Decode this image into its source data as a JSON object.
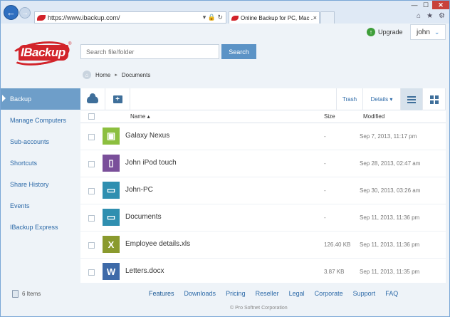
{
  "browser": {
    "url": "https://www.ibackup.com/",
    "tab_title": "Online Backup for PC, Mac ...",
    "tab_close": "×",
    "addr_controls": "▾ 🔒 ↻",
    "win_min": "—",
    "win_max": "☐",
    "win_close": "✕",
    "toolbar_icons": [
      "⌂",
      "★",
      "⚙"
    ]
  },
  "header": {
    "upgrade_label": "Upgrade",
    "upgrade_icon": "↑",
    "user_name": "john",
    "user_caret": "⌄",
    "logo_text": "IBackup",
    "logo_reg": "®"
  },
  "search": {
    "placeholder": "Search file/folder",
    "button": "Search"
  },
  "breadcrumb": {
    "home": "Home",
    "sep": "▸",
    "current": "Documents"
  },
  "sidebar": {
    "items": [
      {
        "label": "Backup",
        "active": true
      },
      {
        "label": "Manage Computers"
      },
      {
        "label": "Sub-accounts"
      },
      {
        "label": "Shortcuts"
      },
      {
        "label": "Share History"
      },
      {
        "label": "Events"
      },
      {
        "label": "IBackup Express"
      }
    ],
    "item_count": "6 Items"
  },
  "toolbar": {
    "trash": "Trash",
    "details": "Details ▾",
    "new_folder_glyph": "+"
  },
  "table": {
    "headers": {
      "name": "Name ▴",
      "size": "Size",
      "modified": "Modified"
    },
    "rows": [
      {
        "name": "Galaxy Nexus",
        "size": "-",
        "modified": "Sep 7, 2013, 11:17 pm",
        "icon": "android-icon",
        "color": "#8cbf3f",
        "glyph": "▣"
      },
      {
        "name": "John iPod touch",
        "size": "-",
        "modified": "Sep 28, 2013, 02:47 am",
        "icon": "ipod-icon",
        "color": "#7a4f9a",
        "glyph": "▯"
      },
      {
        "name": "John-PC",
        "size": "-",
        "modified": "Sep 30, 2013, 03:26 am",
        "icon": "computer-folder-icon",
        "color": "#2f8fb0",
        "glyph": "▭"
      },
      {
        "name": "Documents",
        "size": "-",
        "modified": "Sep 11, 2013, 11:36 pm",
        "icon": "folder-icon",
        "color": "#2f8fb0",
        "glyph": "▭"
      },
      {
        "name": "Employee details.xls",
        "size": "126.40 KB",
        "modified": "Sep 11, 2013, 11:36 pm",
        "icon": "excel-icon",
        "color": "#8a9a2e",
        "glyph": "X"
      },
      {
        "name": "Letters.docx",
        "size": "3.87 KB",
        "modified": "Sep 11, 2013, 11:35 pm",
        "icon": "word-icon",
        "color": "#3e6aa8",
        "glyph": "W"
      }
    ]
  },
  "footer": {
    "links": [
      "Features",
      "Downloads",
      "Pricing",
      "Reseller",
      "Legal",
      "Corporate",
      "Support",
      "FAQ"
    ],
    "copyright": "© Pro Softnet Corporation"
  }
}
